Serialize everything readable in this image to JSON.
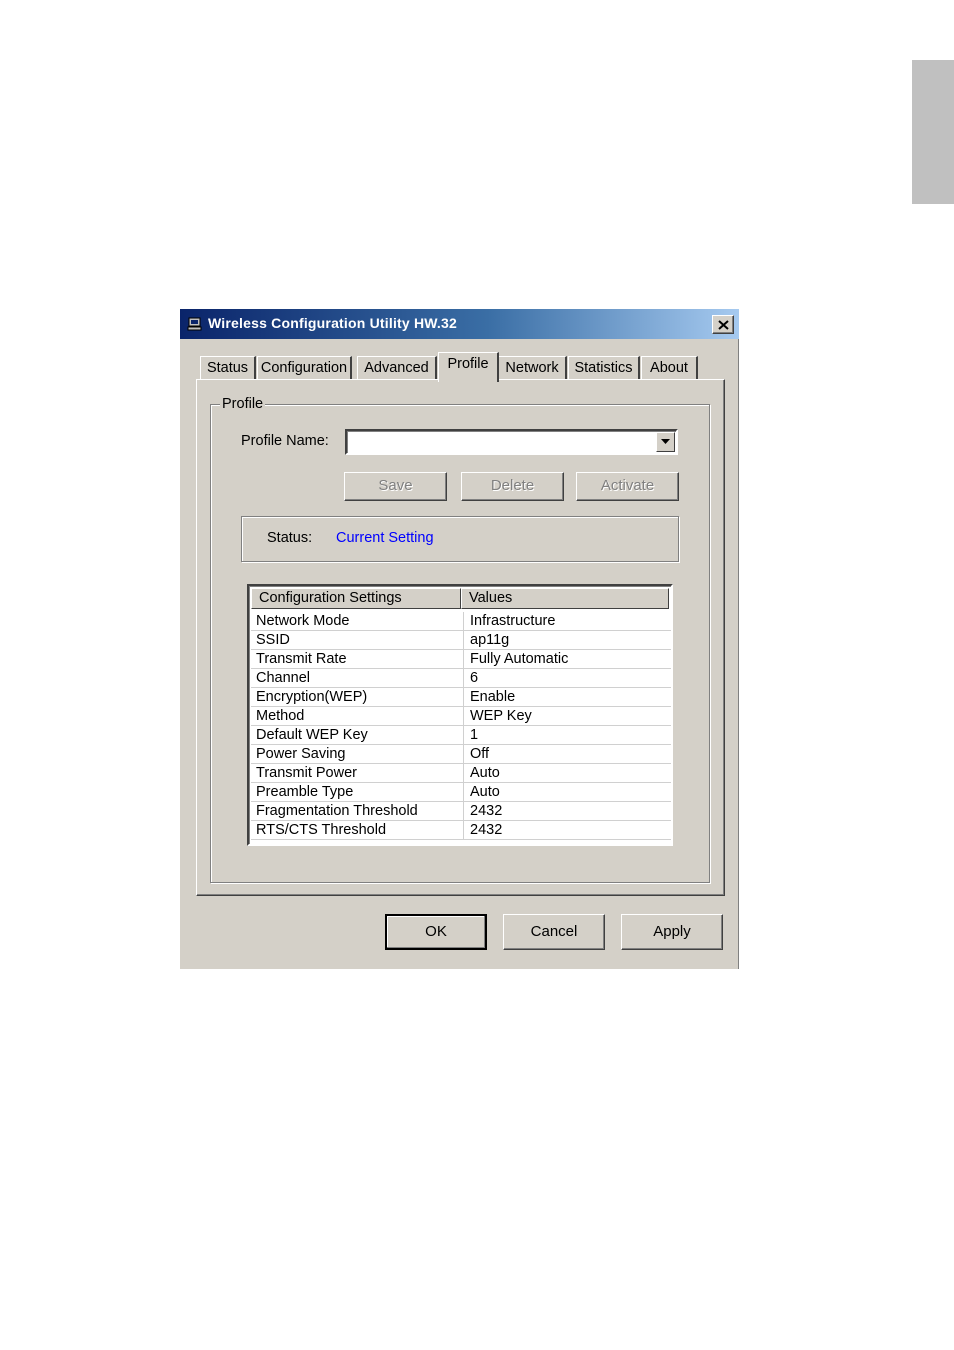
{
  "window": {
    "title": "Wireless Configuration Utility HW.32"
  },
  "tabs": [
    {
      "label": "Status"
    },
    {
      "label": "Configuration"
    },
    {
      "label": "Advanced"
    },
    {
      "label": "Profile",
      "active": true
    },
    {
      "label": "Network"
    },
    {
      "label": "Statistics"
    },
    {
      "label": "About"
    }
  ],
  "profile": {
    "group_label": "Profile",
    "profile_name_label": "Profile Name:",
    "profile_name_value": "",
    "save_label": "Save",
    "delete_label": "Delete",
    "activate_label": "Activate",
    "status_label": "Status:",
    "status_value": "Current Setting",
    "status_color": "#0000ff"
  },
  "settings_table": {
    "headers": [
      "Configuration Settings",
      "Values"
    ],
    "rows": [
      [
        "Network Mode",
        "Infrastructure"
      ],
      [
        "SSID",
        "ap11g"
      ],
      [
        "Transmit Rate",
        "Fully Automatic"
      ],
      [
        "Channel",
        "6"
      ],
      [
        "Encryption(WEP)",
        "Enable"
      ],
      [
        "Method",
        "WEP Key"
      ],
      [
        "Default WEP Key",
        "1"
      ],
      [
        "Power Saving",
        "Off"
      ],
      [
        "Transmit Power",
        "Auto"
      ],
      [
        "Preamble Type",
        "Auto"
      ],
      [
        "Fragmentation Threshold",
        "2432"
      ],
      [
        "RTS/CTS Threshold",
        "2432"
      ]
    ]
  },
  "footer": {
    "ok_label": "OK",
    "cancel_label": "Cancel",
    "apply_label": "Apply"
  },
  "icons": {
    "title_icon": "computer-icon",
    "close_icon": "close-icon",
    "dropdown_icon": "chevron-down-icon"
  },
  "colors": {
    "title_gradient_start": "#0a246a",
    "title_gradient_end": "#a6caf0",
    "dialog_face": "#d4d0c8"
  }
}
